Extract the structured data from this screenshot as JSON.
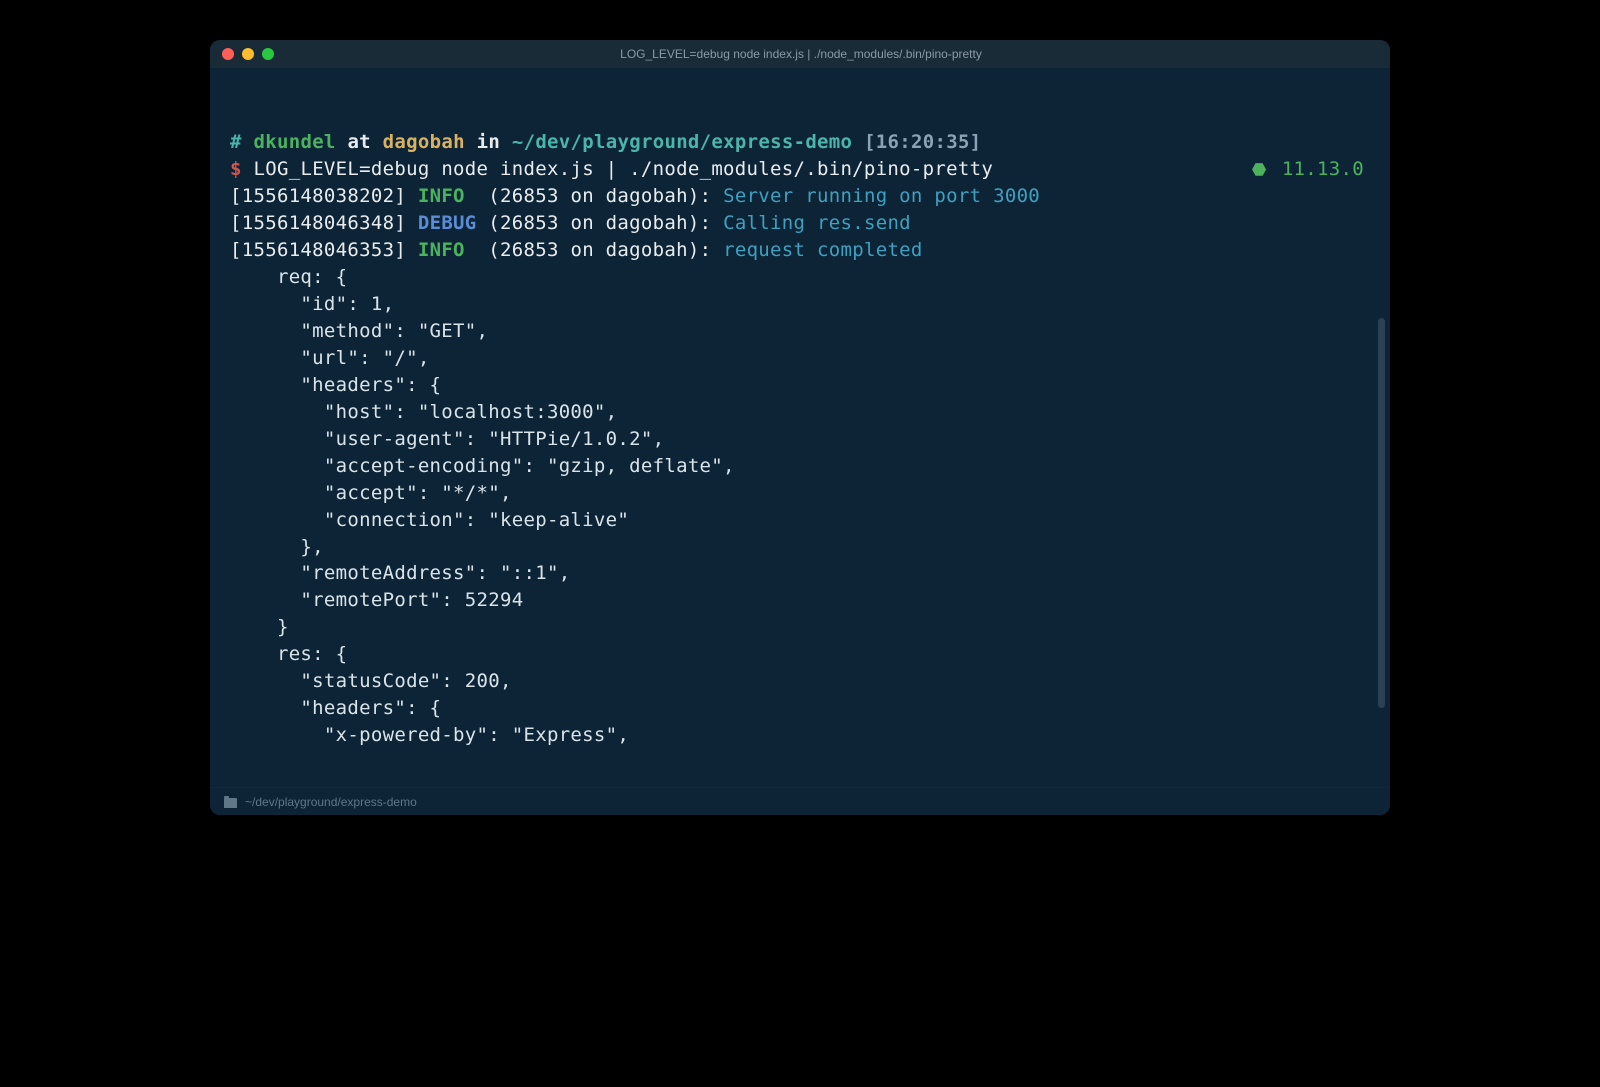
{
  "window": {
    "title": "LOG_LEVEL=debug node index.js | ./node_modules/.bin/pino-pretty"
  },
  "prompt": {
    "hash": "#",
    "user": "dkundel",
    "at": "at",
    "host": "dagobah",
    "in": "in",
    "path": "~/dev/playground/express-demo",
    "time": "[16:20:35]",
    "dollar": "$",
    "command": "LOG_LEVEL=debug node index.js | ./node_modules/.bin/pino-pretty",
    "node_version": "11.13.0"
  },
  "logs": [
    {
      "ts": "[1556148038202]",
      "level": "INFO",
      "lvlClass": "c-green",
      "ctx": "(26853 on dagobah):",
      "msg": "Server running on port 3000"
    },
    {
      "ts": "[1556148046348]",
      "level": "DEBUG",
      "lvlClass": "c-blue",
      "ctx": "(26853 on dagobah):",
      "msg": "Calling res.send"
    },
    {
      "ts": "[1556148046353]",
      "level": "INFO",
      "lvlClass": "c-green",
      "ctx": "(26853 on dagobah):",
      "msg": "request completed"
    }
  ],
  "body_lines": [
    "    req: {",
    "      \"id\": 1,",
    "      \"method\": \"GET\",",
    "      \"url\": \"/\",",
    "      \"headers\": {",
    "        \"host\": \"localhost:3000\",",
    "        \"user-agent\": \"HTTPie/1.0.2\",",
    "        \"accept-encoding\": \"gzip, deflate\",",
    "        \"accept\": \"*/*\",",
    "        \"connection\": \"keep-alive\"",
    "      },",
    "      \"remoteAddress\": \"::1\",",
    "      \"remotePort\": 52294",
    "    }",
    "    res: {",
    "      \"statusCode\": 200,",
    "      \"headers\": {",
    "        \"x-powered-by\": \"Express\","
  ],
  "statusbar": {
    "path": "~/dev/playground/express-demo"
  }
}
